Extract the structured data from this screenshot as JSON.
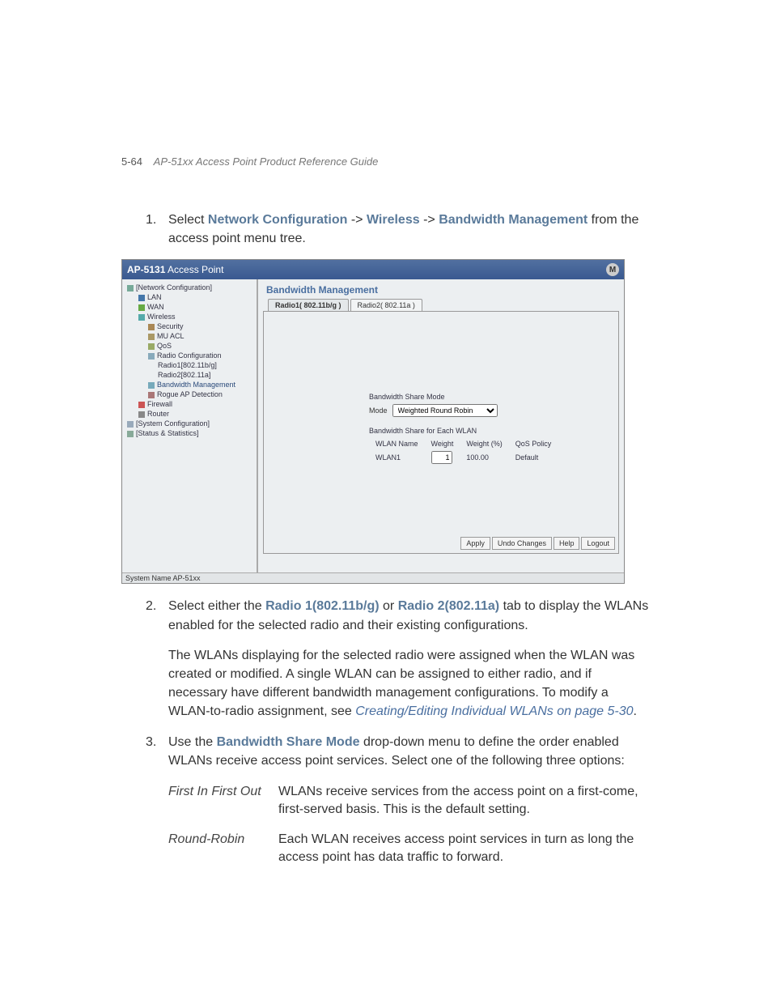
{
  "header": {
    "page_number": "5-64",
    "guide_title": "AP-51xx Access Point Product Reference Guide"
  },
  "steps": {
    "s1": {
      "num": "1.",
      "pre": "Select ",
      "l1": "Network Configuration",
      "arrow1": " -> ",
      "l2": "Wireless",
      "arrow2": " -> ",
      "l3": "Bandwidth Management",
      "post": " from the access point menu tree."
    },
    "s2": {
      "num": "2.",
      "pre": "Select either the ",
      "t1": "Radio 1(802.11b/g)",
      "mid": " or ",
      "t2": "Radio 2(802.11a)",
      "post": " tab to display the WLANs enabled for the selected radio and their existing configurations."
    },
    "s2_para": {
      "text": "The WLANs displaying for the selected radio were assigned when the WLAN was created or modified. A single WLAN can be assigned to either radio, and if necessary have different bandwidth management configurations. To modify a WLAN-to-radio assignment, see ",
      "ref": "Creating/Editing Individual WLANs on page 5-30",
      "dot": "."
    },
    "s3": {
      "num": "3.",
      "pre": "Use the ",
      "l1": "Bandwidth Share Mode",
      "post": " drop-down menu to define the order enabled WLANs receive access point services. Select one of the following three options:"
    }
  },
  "options": {
    "fifo": {
      "term": "First In First Out",
      "desc": "WLANs receive services from the access point on a first-come, first-served basis. This is the default setting."
    },
    "rr": {
      "term": "Round-Robin",
      "desc": "Each WLAN receives access point services in turn as long the access point has data traffic to forward."
    }
  },
  "screenshot": {
    "title_product": "AP-5131",
    "title_suffix": " Access Point",
    "logo": "M",
    "tree": {
      "net": "[Network Configuration]",
      "lan": "LAN",
      "wan": "WAN",
      "wireless": "Wireless",
      "security": "Security",
      "muacl": "MU ACL",
      "qos": "QoS",
      "radiocfg": "Radio Configuration",
      "radio1": "Radio1[802.11b/g]",
      "radio2": "Radio2[802.11a]",
      "bwm": "Bandwidth Management",
      "rogue": "Rogue AP Detection",
      "firewall": "Firewall",
      "router": "Router",
      "syscfg": "[System Configuration]",
      "stats": "[Status & Statistics]"
    },
    "pane": {
      "title": "Bandwidth Management",
      "tab1": "Radio1( 802.11b/g )",
      "tab2": "Radio2( 802.11a )",
      "share_mode_title": "Bandwidth Share Mode",
      "mode_label": "Mode",
      "mode_value": "Weighted Round Robin",
      "share_each_title": "Bandwidth Share for Each WLAN",
      "col_wlan": "WLAN Name",
      "col_weight": "Weight",
      "col_weightpct": "Weight (%)",
      "col_qos": "QoS Policy",
      "row_wlan": "WLAN1",
      "row_weight": "1",
      "row_weightpct": "100.00",
      "row_qos": "Default"
    },
    "buttons": {
      "apply": "Apply",
      "undo": "Undo Changes",
      "help": "Help",
      "logout": "Logout"
    },
    "sysname": "System Name AP-51xx"
  }
}
